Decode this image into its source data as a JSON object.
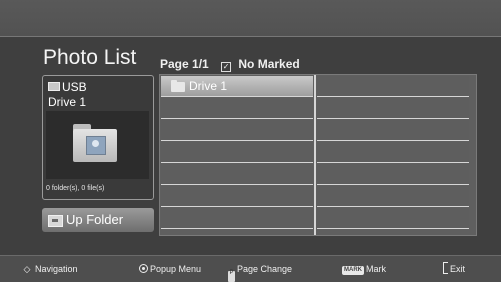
{
  "header": {
    "title": "Photo List",
    "page_label": "Page 1/1",
    "marked_label": "No Marked"
  },
  "device_panel": {
    "device_type": "USB",
    "device_name": "Drive 1",
    "folder_info": "0 folder(s), 0 file(s)",
    "icon": "usb-drive-icon"
  },
  "up_folder_button": {
    "label": "Up Folder",
    "icon": "up-folder-icon"
  },
  "file_grid": {
    "selected_index": 0,
    "items": [
      {
        "label": "Drive 1",
        "icon": "folder-icon"
      }
    ]
  },
  "bottom_bar": {
    "navigation": "Navigation",
    "popup_menu": "Popup Menu",
    "page_change": "Page Change",
    "mark_badge": "MARK",
    "mark": "Mark",
    "exit": "Exit"
  },
  "colors": {
    "background": "#3f3f3f",
    "selected_cell": "#b8b8b8",
    "grid_line": "#d6d6d6",
    "button": "#8a8a8a"
  }
}
